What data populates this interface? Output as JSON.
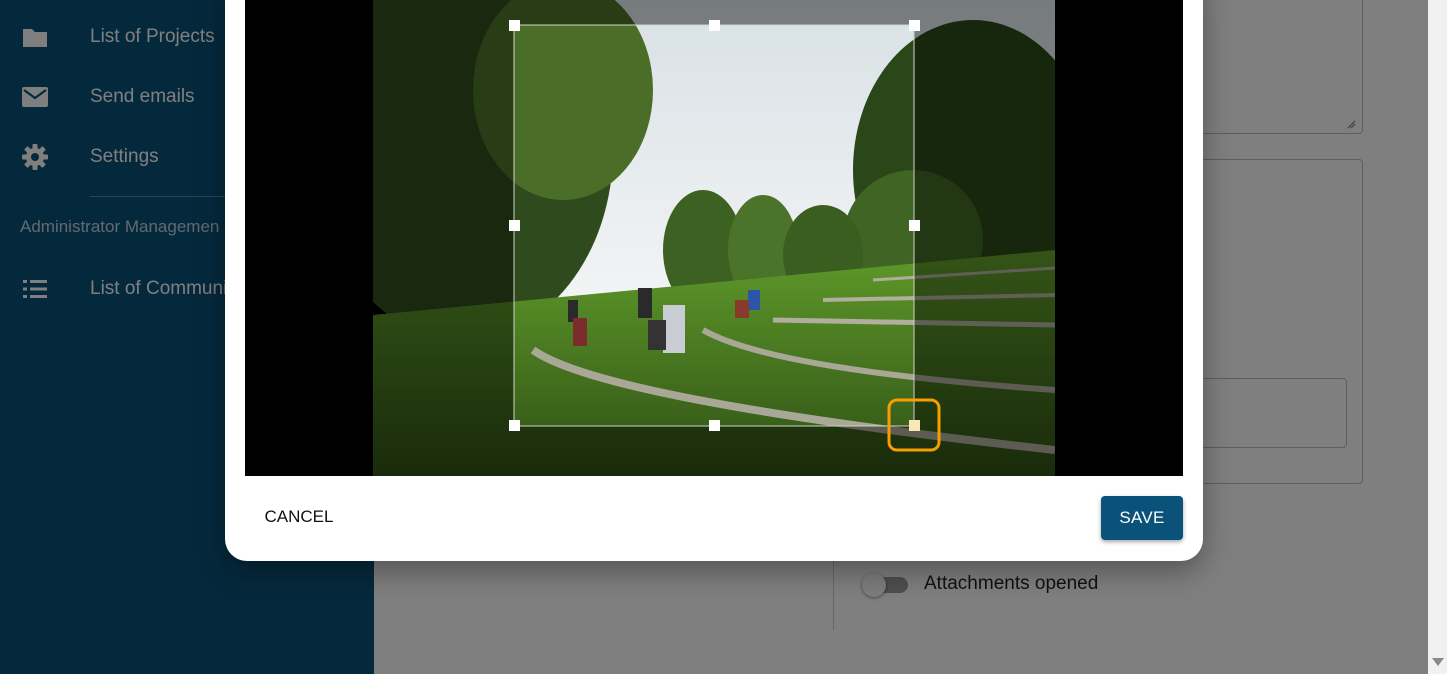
{
  "sidebar": {
    "items": [
      {
        "label": "List of Projects",
        "icon": "folder-icon"
      },
      {
        "label": "Send emails",
        "icon": "mail-icon"
      },
      {
        "label": "Settings",
        "icon": "gear-icon"
      },
      {
        "label": "List of Communi",
        "icon": "list-icon"
      }
    ],
    "section_title": "Administrator Managemen"
  },
  "main": {
    "toggle_label": "Attachments opened",
    "toggle_on": false
  },
  "dialog": {
    "cancel_label": "CANCEL",
    "save_label": "SAVE",
    "image_description_icon": "photo-icon",
    "handle_highlight_color": "#f5a000"
  },
  "colors": {
    "sidebar": "#0a5279",
    "primary_button": "#0a5279"
  }
}
